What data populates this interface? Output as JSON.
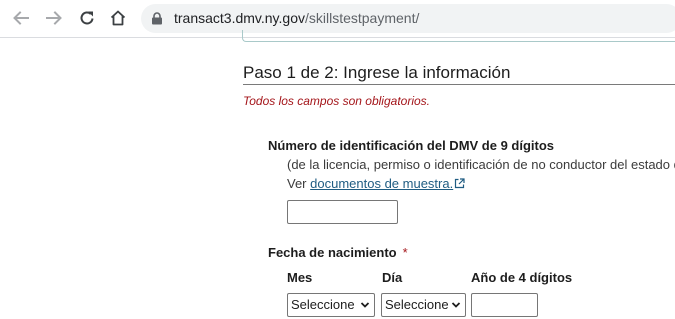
{
  "browser": {
    "url_host": "transact3.dmv.ny.gov",
    "url_path": "/skillstestpayment/"
  },
  "form": {
    "step_title": "Paso 1 de 2: Ingrese la información",
    "required_note": "Todos los campos son obligatorios.",
    "dmv_id": {
      "label": "Número de identificación del DMV de 9 dígitos",
      "help_line1": "(de la licencia, permiso o identificación de no conductor del estado de",
      "help_prefix": "Ver",
      "help_link": "documentos de muestra.",
      "value": ""
    },
    "dob": {
      "label": "Fecha de nacimiento",
      "required_mark": "*",
      "month_label": "Mes",
      "day_label": "Día",
      "year_label": "Año de 4 dígitos",
      "month_value": "Seleccione",
      "day_value": "Seleccione",
      "year_value": ""
    }
  },
  "icons": [
    "back-arrow-icon",
    "forward-arrow-icon",
    "reload-icon",
    "home-icon",
    "lock-icon",
    "external-link-icon",
    "chevron-down-icon"
  ]
}
